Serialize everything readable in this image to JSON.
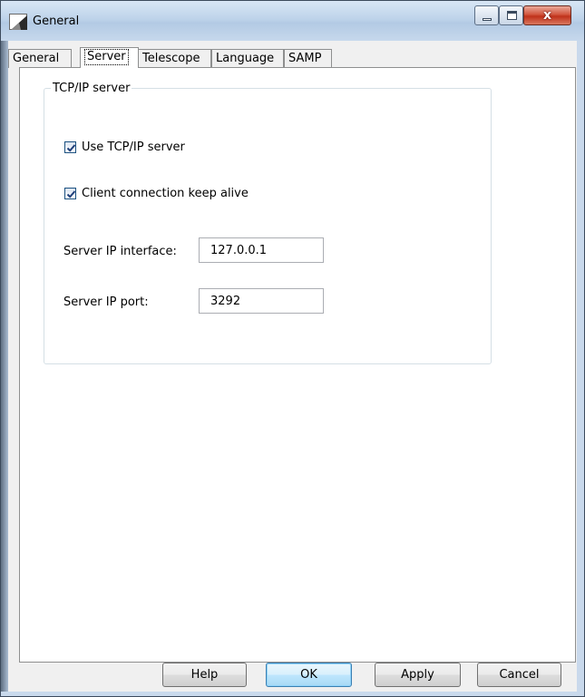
{
  "window": {
    "title": "General",
    "icon": "app-icon",
    "controls": {
      "minimize": "minimize-icon",
      "maximize": "maximize-icon",
      "close_glyph": "x"
    }
  },
  "tabs": [
    {
      "label": "General",
      "active": false
    },
    {
      "label": "Server",
      "active": true
    },
    {
      "label": "Telescope",
      "active": false
    },
    {
      "label": "Language",
      "active": false
    },
    {
      "label": "SAMP",
      "active": false
    }
  ],
  "server_panel": {
    "group_title": "TCP/IP server",
    "use_tcpip": {
      "label": "Use TCP/IP server",
      "checked": true
    },
    "keep_alive": {
      "label": "Client connection keep alive",
      "checked": true
    },
    "ip_interface": {
      "label": "Server IP interface:",
      "value": "127.0.0.1"
    },
    "ip_port": {
      "label": "Server IP port:",
      "value": "3292"
    }
  },
  "buttons": {
    "help": "Help",
    "ok": "OK",
    "apply": "Apply",
    "cancel": "Cancel"
  },
  "colors": {
    "titlebar": "#c0d4ea",
    "close_button": "#c7402a",
    "checkbox_border": "#1c5180",
    "default_button_border": "#3c7fb1"
  }
}
